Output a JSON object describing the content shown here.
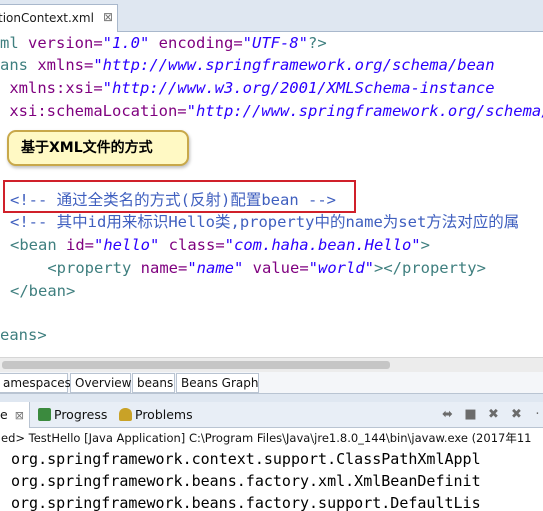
{
  "editor": {
    "tab_label": "tionContext.xml",
    "tab_close": "⊠",
    "lines": [
      {
        "segments": [
          {
            "t": "ml ",
            "c": "pi"
          },
          {
            "t": "version=",
            "c": "attr"
          },
          {
            "t": "\"1.0\"",
            "c": "str"
          },
          {
            "t": " encoding=",
            "c": "attr"
          },
          {
            "t": "\"UTF-8\"",
            "c": "str"
          },
          {
            "t": "?>",
            "c": "pi"
          }
        ]
      },
      {
        "segments": [
          {
            "t": "ans ",
            "c": "el"
          },
          {
            "t": "xmlns=",
            "c": "attr"
          },
          {
            "t": "\"http://www.springframework.org/schema/bean",
            "c": "str"
          }
        ]
      },
      {
        "segments": [
          {
            "t": " xmlns:xsi=",
            "c": "attr"
          },
          {
            "t": "\"http://www.w3.org/2001/XMLSchema-instance",
            "c": "str"
          }
        ]
      },
      {
        "segments": [
          {
            "t": " xsi:schemaLocation=",
            "c": "attr"
          },
          {
            "t": "\"http://www.springframework.org/schema/s",
            "c": "str"
          }
        ]
      },
      {
        "segments": []
      },
      {
        "segments": []
      },
      {
        "segments": []
      },
      {
        "segments": [
          {
            "t": "<!-- 通过全类名的方式(反射)配置bean -->",
            "c": "cm"
          }
        ]
      },
      {
        "segments": [
          {
            "t": "<!-- 其中id用来标识Hello类,property中的name为set方法对应的属",
            "c": "cm"
          }
        ]
      },
      {
        "segments": [
          {
            "t": "<bean ",
            "c": "el"
          },
          {
            "t": "id=",
            "c": "attr"
          },
          {
            "t": "\"hello\"",
            "c": "str"
          },
          {
            "t": " class=",
            "c": "attr"
          },
          {
            "t": "\"com.haha.bean.Hello\"",
            "c": "str"
          },
          {
            "t": ">",
            "c": "el"
          }
        ]
      },
      {
        "segments": [
          {
            "t": "    <property ",
            "c": "el"
          },
          {
            "t": "name=",
            "c": "attr"
          },
          {
            "t": "\"name\"",
            "c": "str"
          },
          {
            "t": " value=",
            "c": "attr"
          },
          {
            "t": "\"world\"",
            "c": "str"
          },
          {
            "t": "></property>",
            "c": "el"
          }
        ]
      },
      {
        "segments": [
          {
            "t": "</bean>",
            "c": "el"
          }
        ]
      },
      {
        "segments": []
      },
      {
        "segments": [
          {
            "t": "eans>",
            "c": "el"
          }
        ]
      }
    ]
  },
  "callout": {
    "text": "基于XML文件的方式"
  },
  "bottom_tabs": [
    "amespaces",
    "Overview",
    "beans",
    "Beans Graph"
  ],
  "console": {
    "tabs": [
      {
        "label": "e",
        "close": "⊠",
        "icon": "console-icon"
      },
      {
        "label": "Progress",
        "icon": "progress-icon"
      },
      {
        "label": "Problems",
        "icon": "problems-icon"
      }
    ],
    "toolbar_icons": [
      "scroll-lock-icon",
      "terminate-icon",
      "remove-launch-icon",
      "remove-all-icon"
    ],
    "status": "ed> TestHello [Java Application] C:\\Program Files\\Java\\jre1.8.0_144\\bin\\javaw.exe (2017年11",
    "output": [
      "org.springframework.context.support.ClassPathXmlAppl",
      "org.springframework.beans.factory.xml.XmlBeanDefinit",
      "org.springframework.beans.factory.support.DefaultLis"
    ]
  }
}
